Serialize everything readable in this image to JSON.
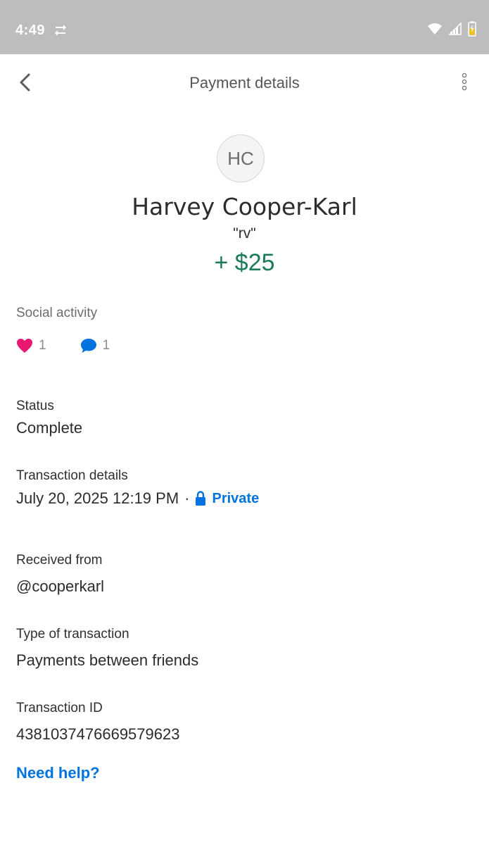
{
  "status_bar": {
    "time": "4:49",
    "icons": [
      "sync-icon",
      "wifi-icon",
      "cell-signal-icon",
      "battery-charging-icon"
    ]
  },
  "app_bar": {
    "title": "Payment details",
    "back_icon": "chevron-left-icon",
    "more_icon": "more-vertical-icon"
  },
  "payment": {
    "avatar_initials": "HC",
    "name": "Harvey Cooper-Karl",
    "note": "\"rv\"",
    "amount": "+ $25",
    "amount_color": "#1b7a5a"
  },
  "social": {
    "label": "Social activity",
    "likes": "1",
    "comments": "1",
    "like_color": "#e8176f",
    "comment_color": "#0074de"
  },
  "status": {
    "label": "Status",
    "value": "Complete"
  },
  "transaction_details": {
    "label": "Transaction details",
    "date": "July 20, 2025 12:19 PM",
    "separator": "·",
    "privacy": "Private",
    "privacy_color": "#0074de"
  },
  "received_from": {
    "label": "Received from",
    "value": "@cooperkarl"
  },
  "transaction_type": {
    "label": "Type of transaction",
    "value": "Payments between friends"
  },
  "transaction_id": {
    "label": "Transaction ID",
    "value": "4381037476669579623"
  },
  "help": {
    "label": "Need help?"
  }
}
